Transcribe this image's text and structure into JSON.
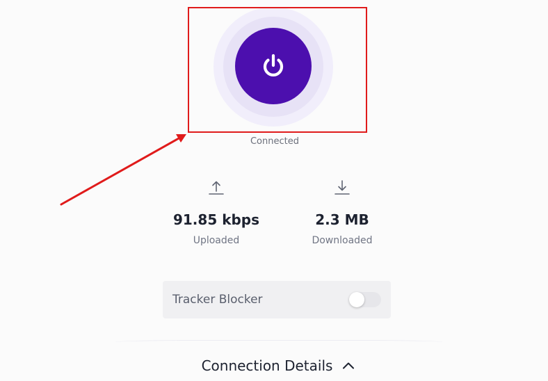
{
  "status": {
    "label": "Connected"
  },
  "stats": {
    "upload": {
      "icon": "upload-arrow-icon",
      "value": "91.85 kbps",
      "label": "Uploaded"
    },
    "download": {
      "icon": "download-arrow-icon",
      "value": "2.3 MB",
      "label": "Downloaded"
    }
  },
  "tracker_blocker": {
    "label": "Tracker Blocker",
    "enabled": false
  },
  "connection_details": {
    "label": "Connection Details",
    "icon": "chevron-up-icon"
  },
  "colors": {
    "accent": "#4c0fae",
    "annotation": "#e01b1b"
  }
}
